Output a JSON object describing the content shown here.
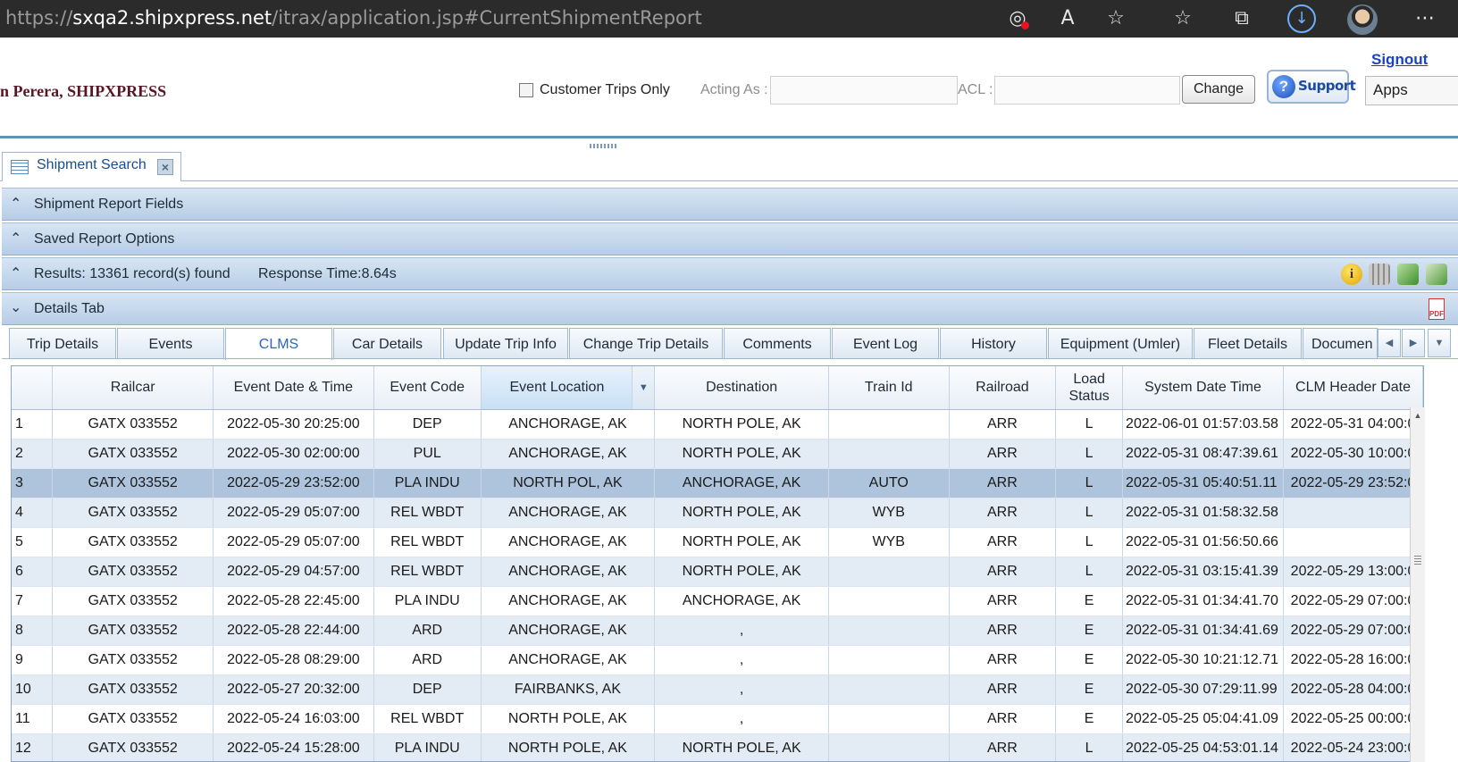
{
  "browser": {
    "url_prefix": "https://",
    "url_host": "sxqa2.shipxpress.net",
    "url_path": "/itrax/application.jsp#CurrentShipmentReport"
  },
  "header": {
    "user": "n Perera, SHIPXPRESS",
    "customer_trips_only": "Customer Trips Only",
    "acting_as_label": "Acting As :",
    "acl_label": "ACL :",
    "change_button": "Change",
    "support_button": "Support",
    "signout": "Signout",
    "apps": "Apps"
  },
  "tabs": {
    "main": "Shipment Search"
  },
  "panels": {
    "report_fields": "Shipment Report Fields",
    "saved_options": "Saved Report Options",
    "results": "Results: 13361 record(s) found",
    "response_time": "Response Time:8.64s",
    "details": "Details Tab"
  },
  "inner_tabs": [
    "Trip Details",
    "Events",
    "CLMS",
    "Car Details",
    "Update Trip Info",
    "Change Trip Details",
    "Comments",
    "Event Log",
    "History",
    "Equipment (Umler)",
    "Fleet Details",
    "Documen"
  ],
  "grid": {
    "columns": [
      "",
      "Railcar",
      "Event Date & Time",
      "Event Code",
      "Event Location",
      "Destination",
      "Train Id",
      "Railroad",
      "Load Status",
      "System Date Time",
      "CLM Header Date"
    ],
    "rows": [
      [
        "1",
        "GATX 033552",
        "2022-05-30 20:25:00",
        "DEP",
        "ANCHORAGE, AK",
        "NORTH POLE, AK",
        "",
        "ARR",
        "L",
        "2022-06-01 01:57:03.58",
        "2022-05-31 04:00:0"
      ],
      [
        "2",
        "GATX 033552",
        "2022-05-30 02:00:00",
        "PUL",
        "ANCHORAGE, AK",
        "NORTH POLE, AK",
        "",
        "ARR",
        "L",
        "2022-05-31 08:47:39.61",
        "2022-05-30 10:00:0"
      ],
      [
        "3",
        "GATX 033552",
        "2022-05-29 23:52:00",
        "PLA INDU",
        "NORTH POL, AK",
        "ANCHORAGE, AK",
        "AUTO",
        "ARR",
        "L",
        "2022-05-31 05:40:51.11",
        "2022-05-29 23:52:0"
      ],
      [
        "4",
        "GATX 033552",
        "2022-05-29 05:07:00",
        "REL WBDT",
        "ANCHORAGE, AK",
        "NORTH POLE, AK",
        "WYB",
        "ARR",
        "L",
        "2022-05-31 01:58:32.58",
        ""
      ],
      [
        "5",
        "GATX 033552",
        "2022-05-29 05:07:00",
        "REL WBDT",
        "ANCHORAGE, AK",
        "NORTH POLE, AK",
        "WYB",
        "ARR",
        "L",
        "2022-05-31 01:56:50.66",
        ""
      ],
      [
        "6",
        "GATX 033552",
        "2022-05-29 04:57:00",
        "REL WBDT",
        "ANCHORAGE, AK",
        "NORTH POLE, AK",
        "",
        "ARR",
        "L",
        "2022-05-31 03:15:41.39",
        "2022-05-29 13:00:0"
      ],
      [
        "7",
        "GATX 033552",
        "2022-05-28 22:45:00",
        "PLA INDU",
        "ANCHORAGE, AK",
        "ANCHORAGE, AK",
        "",
        "ARR",
        "E",
        "2022-05-31 01:34:41.70",
        "2022-05-29 07:00:0"
      ],
      [
        "8",
        "GATX 033552",
        "2022-05-28 22:44:00",
        "ARD",
        "ANCHORAGE, AK",
        ",",
        "",
        "ARR",
        "E",
        "2022-05-31 01:34:41.69",
        "2022-05-29 07:00:0"
      ],
      [
        "9",
        "GATX 033552",
        "2022-05-28 08:29:00",
        "ARD",
        "ANCHORAGE, AK",
        ",",
        "",
        "ARR",
        "E",
        "2022-05-30 10:21:12.71",
        "2022-05-28 16:00:0"
      ],
      [
        "10",
        "GATX 033552",
        "2022-05-27 20:32:00",
        "DEP",
        "FAIRBANKS, AK",
        ",",
        "",
        "ARR",
        "E",
        "2022-05-30 07:29:11.99",
        "2022-05-28 04:00:0"
      ],
      [
        "11",
        "GATX 033552",
        "2022-05-24 16:03:00",
        "REL WBDT",
        "NORTH POLE, AK",
        ",",
        "",
        "ARR",
        "E",
        "2022-05-25 05:04:41.09",
        "2022-05-25 00:00:0"
      ],
      [
        "12",
        "GATX 033552",
        "2022-05-24 15:28:00",
        "PLA INDU",
        "NORTH POLE, AK",
        "NORTH POLE, AK",
        "",
        "ARR",
        "L",
        "2022-05-25 04:53:01.14",
        "2022-05-24 23:00:0"
      ]
    ],
    "selected_row": 3
  }
}
